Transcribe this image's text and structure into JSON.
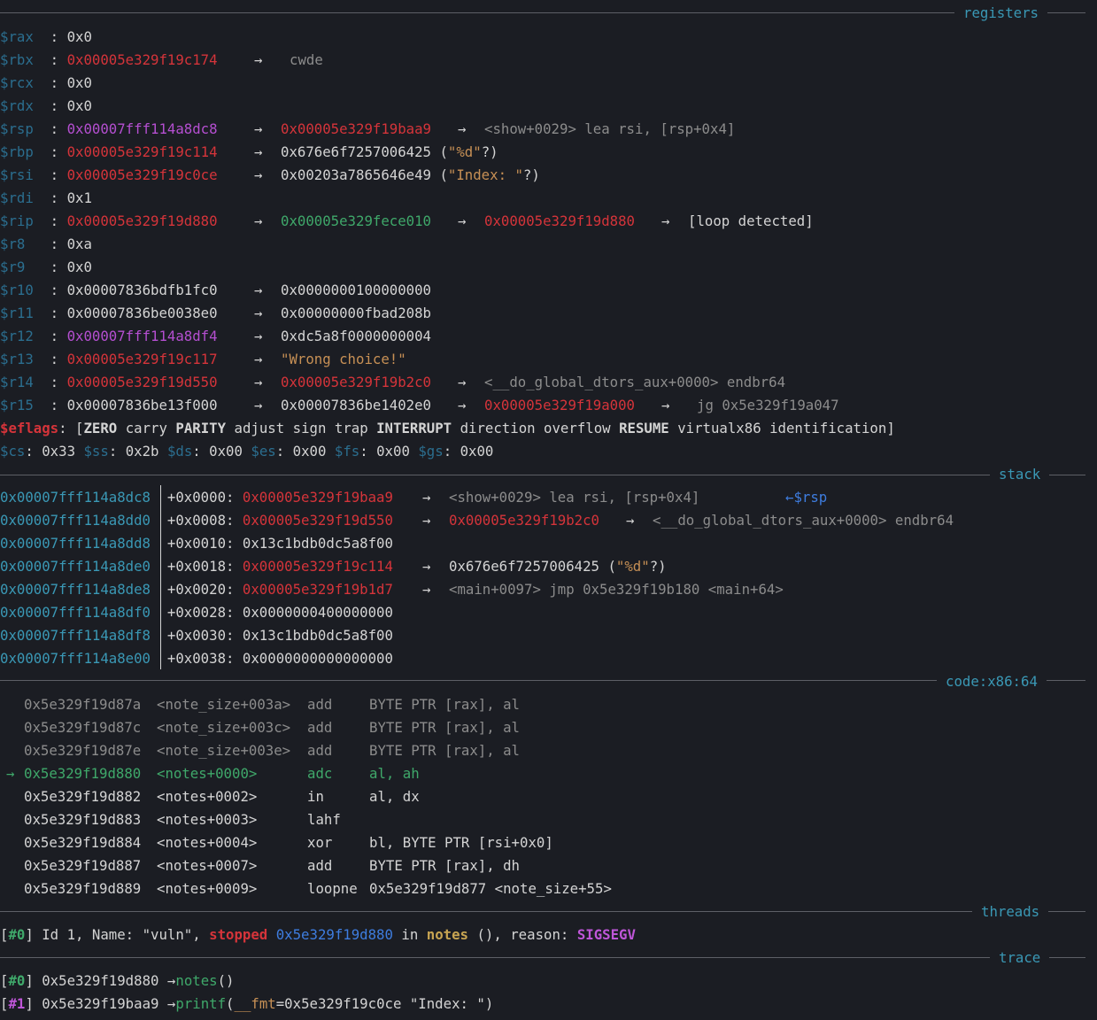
{
  "sections": {
    "registers": "registers",
    "stack": "stack",
    "code": "code:x86:64",
    "threads": "threads",
    "trace": "trace"
  },
  "registers": [
    {
      "name": "$rax",
      "value": "0x0",
      "chain": []
    },
    {
      "name": "$rbx",
      "value": "0x00005e329f19c174",
      "chain": [
        "cwde"
      ]
    },
    {
      "name": "$rcx",
      "value": "0x0",
      "chain": []
    },
    {
      "name": "$rdx",
      "value": "0x0",
      "chain": []
    },
    {
      "name": "$rsp",
      "value": "0x00007fff114a8dc8",
      "chain": [
        "0x00005e329f19baa9",
        "<show+0029> lea rsi, [rsp+0x4]"
      ]
    },
    {
      "name": "$rbp",
      "value": "0x00005e329f19c114",
      "chain": [
        "0x676e6f7257006425 (\"%d\"?)"
      ]
    },
    {
      "name": "$rsi",
      "value": "0x00005e329f19c0ce",
      "chain": [
        "0x00203a7865646e49 (\"Index: \"?)"
      ]
    },
    {
      "name": "$rdi",
      "value": "0x1",
      "chain": []
    },
    {
      "name": "$rip",
      "value": "0x00005e329f19d880",
      "chain": [
        "0x00005e329fece010",
        "0x00005e329f19d880",
        "[loop detected]"
      ]
    },
    {
      "name": "$r8",
      "value": "0xa",
      "chain": []
    },
    {
      "name": "$r9",
      "value": "0x0",
      "chain": []
    },
    {
      "name": "$r10",
      "value": "0x00007836bdfb1fc0",
      "chain": [
        "0x0000000100000000"
      ]
    },
    {
      "name": "$r11",
      "value": "0x00007836be0038e0",
      "chain": [
        "0x00000000fbad208b"
      ]
    },
    {
      "name": "$r12",
      "value": "0x00007fff114a8df4",
      "chain": [
        "0xdc5a8f0000000004"
      ]
    },
    {
      "name": "$r13",
      "value": "0x00005e329f19c117",
      "chain": [
        "\"Wrong choice!\""
      ]
    },
    {
      "name": "$r14",
      "value": "0x00005e329f19d550",
      "chain": [
        "0x00005e329f19b2c0",
        "<__do_global_dtors_aux+0000> endbr64"
      ]
    },
    {
      "name": "$r15",
      "value": "0x00007836be13f000",
      "chain": [
        "0x00007836be1402e0",
        "0x00005e329f19a000",
        "jg 0x5e329f19a047"
      ]
    }
  ],
  "eflags": {
    "label": "$eflags",
    "flags": [
      "ZERO",
      "carry",
      "PARITY",
      "adjust",
      "sign",
      "trap",
      "INTERRUPT",
      "direction",
      "overflow",
      "RESUME",
      "virtualx86",
      "identification"
    ]
  },
  "segments": [
    {
      "name": "$cs",
      "value": "0x33"
    },
    {
      "name": "$ss",
      "value": "0x2b"
    },
    {
      "name": "$ds",
      "value": "0x00"
    },
    {
      "name": "$es",
      "value": "0x00"
    },
    {
      "name": "$fs",
      "value": "0x00"
    },
    {
      "name": "$gs",
      "value": "0x00"
    }
  ],
  "stack": [
    {
      "addr": "0x00007fff114a8dc8",
      "off": "+0x0000:",
      "value": "0x00005e329f19baa9",
      "rest": [
        "<show+0029> lea rsi, [rsp+0x4]"
      ],
      "marker": "←$rsp"
    },
    {
      "addr": "0x00007fff114a8dd0",
      "off": "+0x0008:",
      "value": "0x00005e329f19d550",
      "rest": [
        "0x00005e329f19b2c0",
        "<__do_global_dtors_aux+0000> endbr64"
      ]
    },
    {
      "addr": "0x00007fff114a8dd8",
      "off": "+0x0010:",
      "value": "0x13c1bdb0dc5a8f00",
      "rest": []
    },
    {
      "addr": "0x00007fff114a8de0",
      "off": "+0x0018:",
      "value": "0x00005e329f19c114",
      "rest": [
        "0x676e6f7257006425 (\"%d\"?)"
      ]
    },
    {
      "addr": "0x00007fff114a8de8",
      "off": "+0x0020:",
      "value": "0x00005e329f19b1d7",
      "rest": [
        "<main+0097> jmp 0x5e329f19b180 <main+64>"
      ]
    },
    {
      "addr": "0x00007fff114a8df0",
      "off": "+0x0028:",
      "value": "0x0000000400000000",
      "rest": []
    },
    {
      "addr": "0x00007fff114a8df8",
      "off": "+0x0030:",
      "value": "0x13c1bdb0dc5a8f00",
      "rest": []
    },
    {
      "addr": "0x00007fff114a8e00",
      "off": "+0x0038:",
      "value": "0x0000000000000000",
      "rest": []
    }
  ],
  "code": [
    {
      "addr": "0x5e329f19d87a",
      "sym": "<note_size+003a>",
      "mn": "add",
      "ops": "BYTE PTR [rax], al",
      "state": "past"
    },
    {
      "addr": "0x5e329f19d87c",
      "sym": "<note_size+003c>",
      "mn": "add",
      "ops": "BYTE PTR [rax], al",
      "state": "past"
    },
    {
      "addr": "0x5e329f19d87e",
      "sym": "<note_size+003e>",
      "mn": "add",
      "ops": "BYTE PTR [rax], al",
      "state": "past"
    },
    {
      "addr": "0x5e329f19d880",
      "sym": "<notes+0000>",
      "mn": "adc",
      "ops": "al, ah",
      "state": "current",
      "arrow": "→"
    },
    {
      "addr": "0x5e329f19d882",
      "sym": "<notes+0002>",
      "mn": "in",
      "ops": "al, dx",
      "state": "next"
    },
    {
      "addr": "0x5e329f19d883",
      "sym": "<notes+0003>",
      "mn": "lahf",
      "ops": "",
      "state": "next"
    },
    {
      "addr": "0x5e329f19d884",
      "sym": "<notes+0004>",
      "mn": "xor",
      "ops": "bl, BYTE PTR [rsi+0x0]",
      "state": "next"
    },
    {
      "addr": "0x5e329f19d887",
      "sym": "<notes+0007>",
      "mn": "add",
      "ops": "BYTE PTR [rax], dh",
      "state": "next"
    },
    {
      "addr": "0x5e329f19d889",
      "sym": "<notes+0009>",
      "mn": "loopne",
      "ops": "0x5e329f19d877 <note_size+55>",
      "state": "next"
    }
  ],
  "thread": {
    "idx": "#0",
    "id_name": "Id 1, Name: \"vuln\",",
    "state": "stopped",
    "addr": "0x5e329f19d880",
    "in": "in",
    "func": "notes",
    "paren": "(),",
    "reason_label": "reason:",
    "reason": "SIGSEGV"
  },
  "trace": [
    {
      "idx": "#0",
      "addr": "0x5e329f19d880",
      "arrow": "→",
      "func": "notes",
      "args": "()"
    },
    {
      "idx": "#1",
      "addr": "0x5e329f19baa9",
      "arrow": "→",
      "func": "printf",
      "args_open": "(",
      "arg_name": "__fmt",
      "args_rest": "=0x5e329f19c0ce \"Index: \")"
    }
  ],
  "colors": {
    "background": "#1b1d23",
    "text": "#d4d4d4",
    "register_name": "#2b6e8f",
    "pointer_red": "#d5343a",
    "stack_magenta": "#b54fd1",
    "code_green": "#3fa86a",
    "section_teal": "#3a98b5"
  }
}
